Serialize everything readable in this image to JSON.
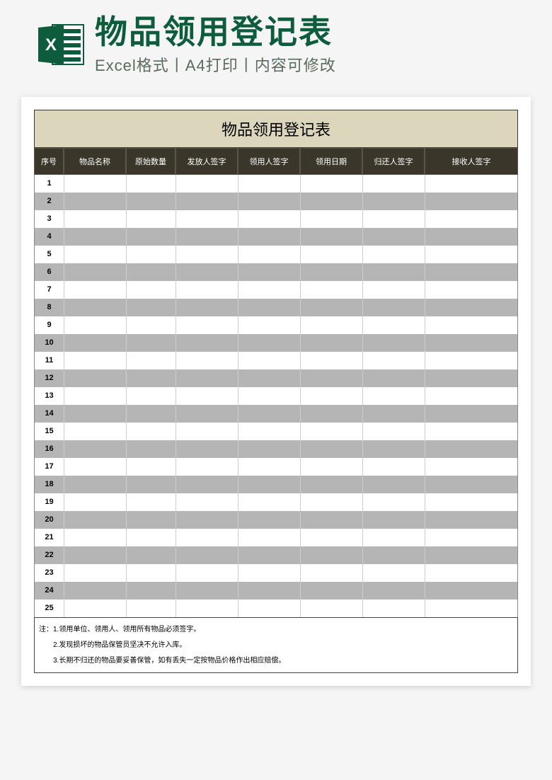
{
  "banner": {
    "title": "物品领用登记表",
    "subtitle": "Excel格式丨A4打印丨内容可修改"
  },
  "form": {
    "title": "物品领用登记表",
    "columns": [
      "序号",
      "物品名称",
      "原始数量",
      "发放人签字",
      "领用人签字",
      "领用日期",
      "归还人签字",
      "接收人签字"
    ],
    "rows": [
      {
        "seq": "1"
      },
      {
        "seq": "2"
      },
      {
        "seq": "3"
      },
      {
        "seq": "4"
      },
      {
        "seq": "5"
      },
      {
        "seq": "6"
      },
      {
        "seq": "7"
      },
      {
        "seq": "8"
      },
      {
        "seq": "9"
      },
      {
        "seq": "10"
      },
      {
        "seq": "11"
      },
      {
        "seq": "12"
      },
      {
        "seq": "13"
      },
      {
        "seq": "14"
      },
      {
        "seq": "15"
      },
      {
        "seq": "16"
      },
      {
        "seq": "17"
      },
      {
        "seq": "18"
      },
      {
        "seq": "19"
      },
      {
        "seq": "20"
      },
      {
        "seq": "21"
      },
      {
        "seq": "22"
      },
      {
        "seq": "23"
      },
      {
        "seq": "24"
      },
      {
        "seq": "25"
      }
    ],
    "notes_label": "注：",
    "notes": [
      "1.领用单位、领用人、领用所有物品必须签字。",
      "2.发现损坏的物品保管员坚决不允许入库。",
      "3.长期不归还的物品要妥善保管，如有丢失一定按物品价格作出相应赔偿。"
    ]
  }
}
